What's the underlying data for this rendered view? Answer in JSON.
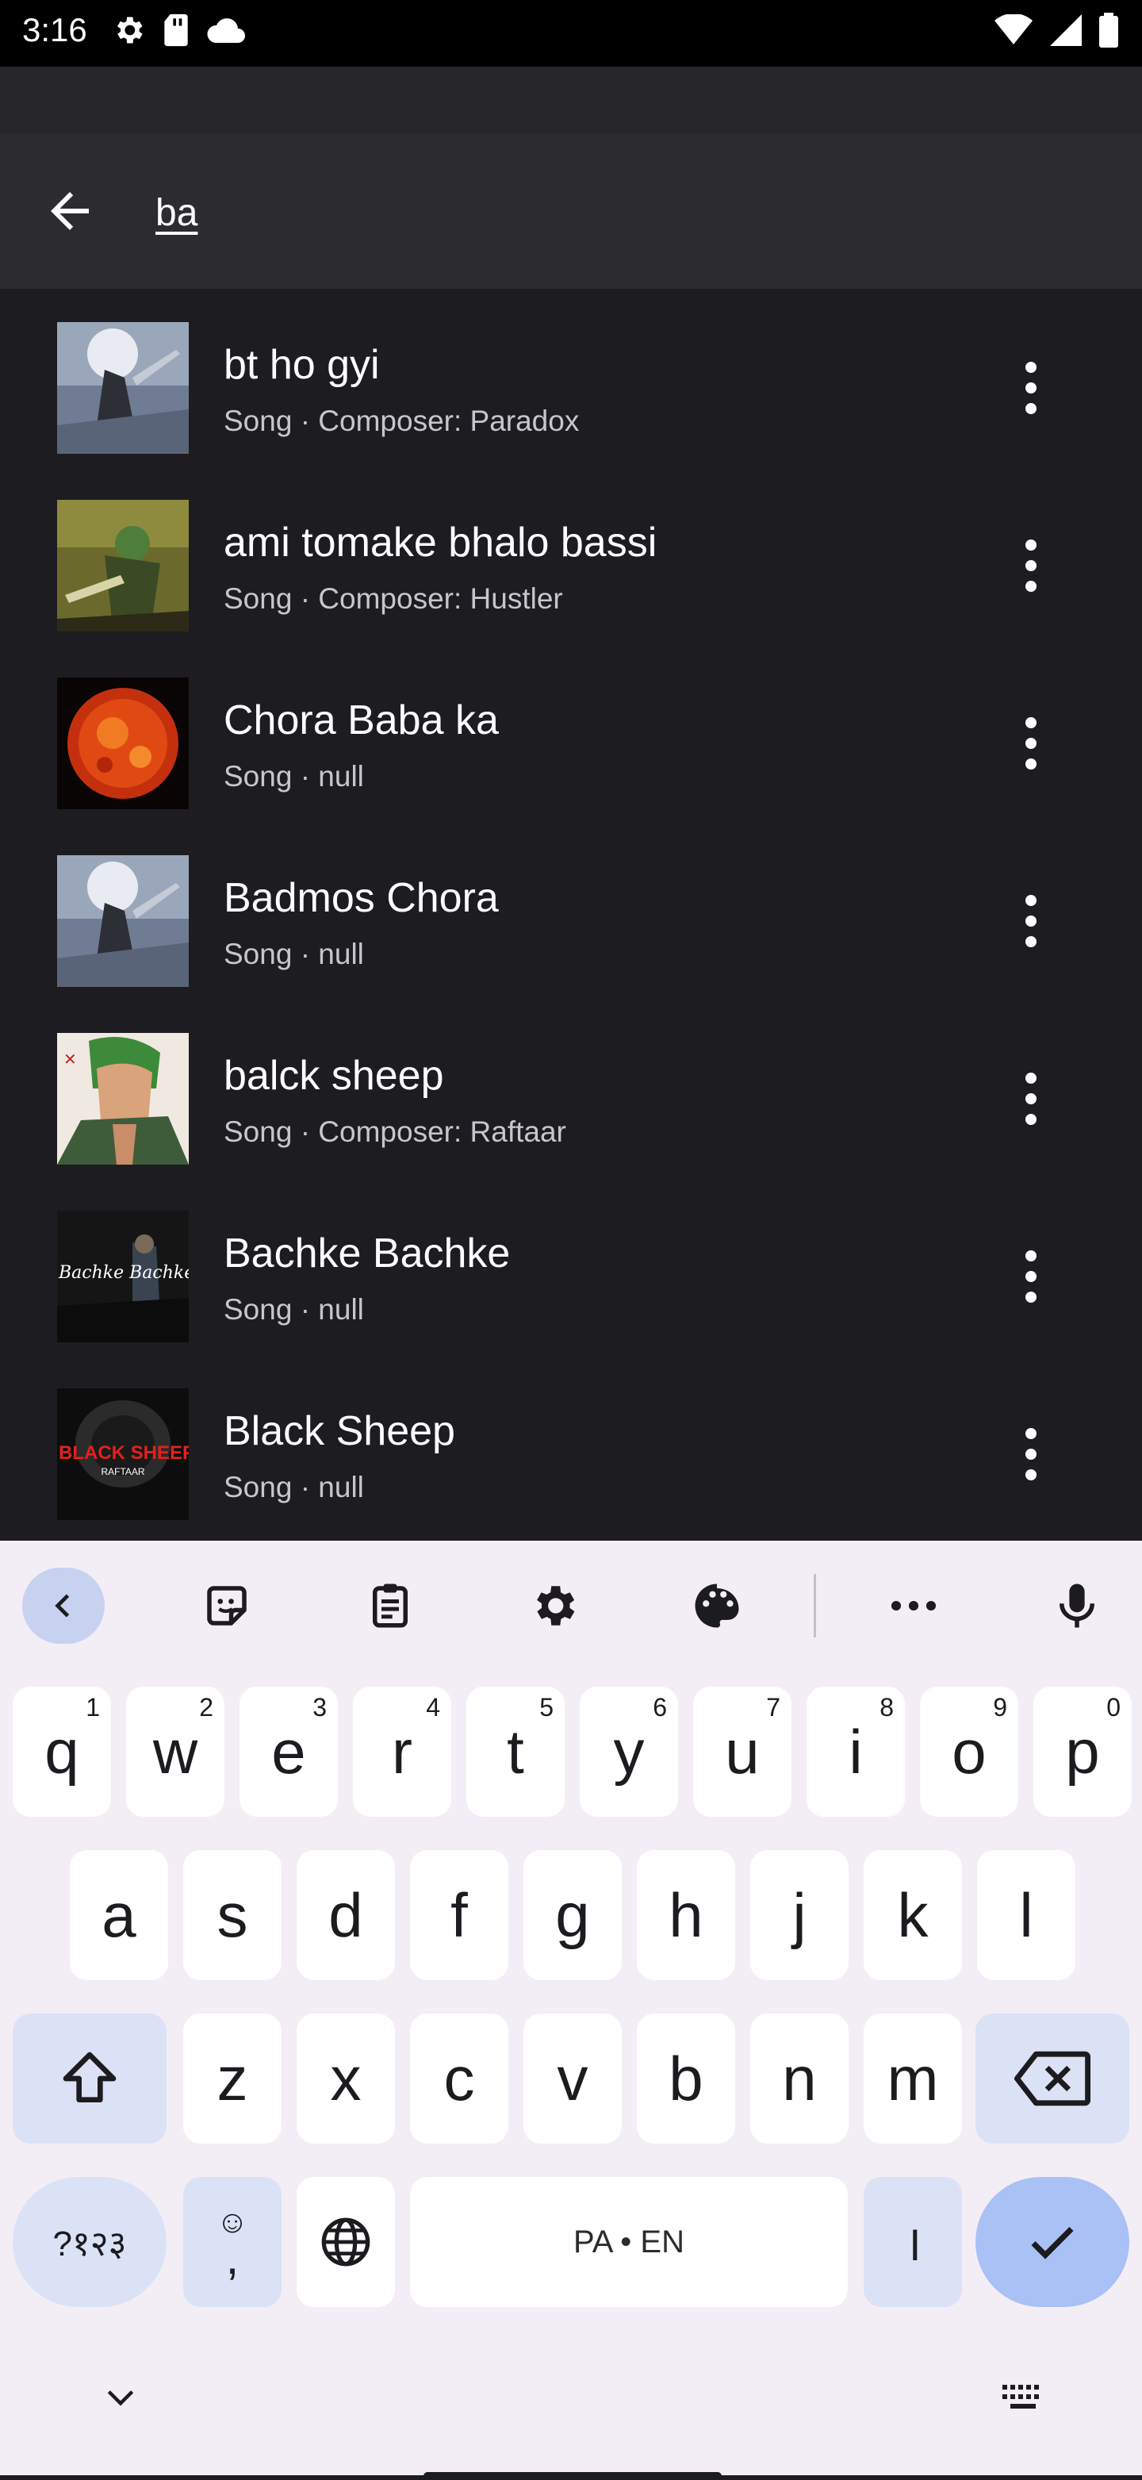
{
  "status_bar": {
    "time": "3:16",
    "left_icons": [
      "settings-icon",
      "sd-card-icon",
      "cloud-icon"
    ],
    "right_icons": [
      "wifi-icon",
      "signal-icon",
      "battery-icon"
    ]
  },
  "search": {
    "query": "ba",
    "back_icon": "arrow-left-icon"
  },
  "results": [
    {
      "title": "bt ho gyi",
      "subtitle": "Song · Composer: Paradox",
      "art": "moon-samurai"
    },
    {
      "title": "ami tomake bhalo bassi",
      "subtitle": "Song · Composer: Hustler",
      "art": "green-warrior"
    },
    {
      "title": "Chora Baba ka",
      "subtitle": "Song · null",
      "art": "sun"
    },
    {
      "title": "Badmos Chora",
      "subtitle": "Song · null",
      "art": "moon-samurai"
    },
    {
      "title": "balck sheep",
      "subtitle": "Song · Composer: Raftaar",
      "art": "green-hair-portrait"
    },
    {
      "title": "Bachke Bachke",
      "subtitle": "Song · null",
      "art": "bachke-cover"
    },
    {
      "title": "Black Sheep",
      "subtitle": "Song · null",
      "art": "black-sheep-cover"
    }
  ],
  "art_text": {
    "bachke": "Bachke Bachke",
    "black_sheep": "BLACK SHEEP",
    "raftaar": "RAFTAAR"
  },
  "keyboard": {
    "toolbar": [
      "chevron-left-icon",
      "sticker-icon",
      "clipboard-icon",
      "gear-icon",
      "palette-icon",
      "more-horiz-icon",
      "mic-icon"
    ],
    "row1": [
      {
        "k": "q",
        "h": "1"
      },
      {
        "k": "w",
        "h": "2"
      },
      {
        "k": "e",
        "h": "3"
      },
      {
        "k": "r",
        "h": "4"
      },
      {
        "k": "t",
        "h": "5"
      },
      {
        "k": "y",
        "h": "6"
      },
      {
        "k": "u",
        "h": "7"
      },
      {
        "k": "i",
        "h": "8"
      },
      {
        "k": "o",
        "h": "9"
      },
      {
        "k": "p",
        "h": "0"
      }
    ],
    "row2": [
      "a",
      "s",
      "d",
      "f",
      "g",
      "h",
      "j",
      "k",
      "l"
    ],
    "row3": [
      "z",
      "x",
      "c",
      "v",
      "b",
      "n",
      "m"
    ],
    "symbols_label": "?१२३",
    "comma_label": ",",
    "emoji_label": "☺",
    "space_label": "PA • EN",
    "danda_label": "।",
    "accent_color": "#a9c1f5"
  },
  "nav": {
    "hide_keyboard_icon": "chevron-down-icon",
    "switch_keyboard_icon": "keyboard-icon"
  }
}
